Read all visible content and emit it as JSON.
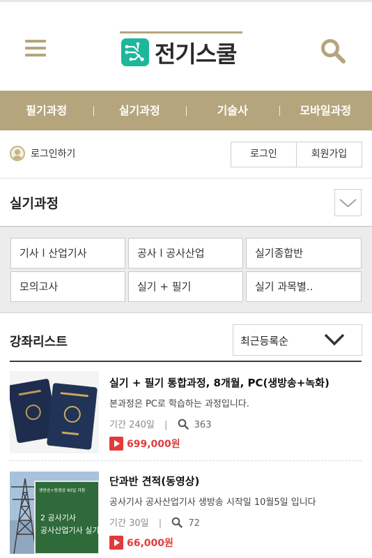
{
  "header": {
    "logo_text": "전기스쿨",
    "menu_icon": "hamburger-icon",
    "search_icon": "magnifier-icon",
    "accent_color": "#b5a57c",
    "logo_color": "#1db79b"
  },
  "nav": {
    "items": [
      "필기과정",
      "실기과정",
      "기술사",
      "모바일과정"
    ]
  },
  "login": {
    "prompt": "로그인하기",
    "login_button": "로그인",
    "signup_button": "회원가입"
  },
  "section": {
    "title": "실기과정"
  },
  "categories": [
    "기사 l 산업기사",
    "공사 l 공사산업",
    "실기종합반",
    "모의고사",
    "실기 + 필기",
    "실기 과목별.."
  ],
  "list": {
    "title": "강좌리스트",
    "sort_selected": "최근등록순"
  },
  "courses": [
    {
      "title": "실기 + 필기 통합과정, 8개월, PC(생방송+녹화)",
      "desc": "본과정은 PC로 학습하는 과정입니다.",
      "period_label": "기간",
      "period": "240일",
      "views": "363",
      "price": "699,000원"
    },
    {
      "title": "단과반 견적(동영상)",
      "desc": "공사기사 공사산업기사 생방송 시작일 10월5일 입니다",
      "period_label": "기간",
      "period": "30일",
      "views": "72",
      "price": "66,000원",
      "sign_lines": [
        "생방송+동영상 90일 과정",
        "2 공사기사",
        "공사산업기사 실기"
      ]
    }
  ],
  "colors": {
    "price": "#e03c3c",
    "divider": "#3b3b3b"
  }
}
